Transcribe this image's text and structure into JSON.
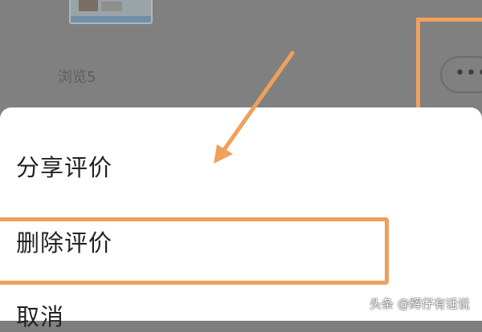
{
  "post": {
    "view_count_label": "浏览5",
    "more_icon": "more-horizontal-icon",
    "more_text": "•••"
  },
  "action_sheet": {
    "items": [
      {
        "label": "分享评价"
      },
      {
        "label": "删除评价"
      },
      {
        "label": "取消"
      }
    ]
  },
  "annotations": {
    "highlight_color": "#f0a05a",
    "arrow_icon": "pointer-arrow-icon"
  },
  "watermark": {
    "text": "头条 @辉仔有话说"
  }
}
